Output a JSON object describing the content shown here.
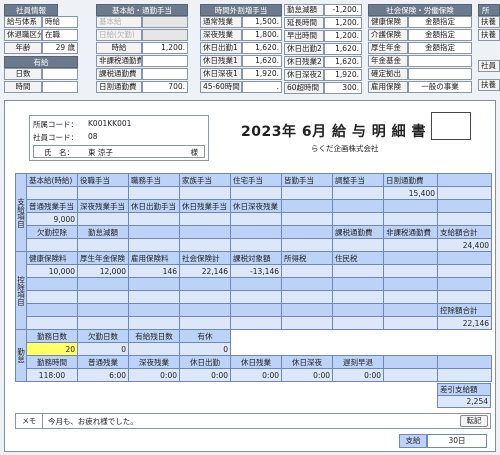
{
  "top": {
    "shain": {
      "title": "社員情報",
      "rows": [
        [
          "給与体系",
          "時給"
        ],
        [
          "休退職区分",
          "在職"
        ],
        [
          "年齢",
          "29 歳"
        ]
      ],
      "yukyu": {
        "title": "有給",
        "rows": [
          [
            "日数",
            ""
          ],
          [
            "時間",
            ""
          ]
        ]
      }
    },
    "kihon": {
      "title": "基本給・通勤手当",
      "rows": [
        [
          "基本給",
          ""
        ],
        [
          "日給(欠勤)",
          ""
        ],
        [
          "時給",
          "1,200."
        ],
        [
          "非課税通勤費",
          ""
        ],
        [
          "課税通勤費",
          ""
        ],
        [
          "日割通勤費",
          "700."
        ]
      ]
    },
    "jikangai": {
      "title": "時間外割増手当",
      "rows": [
        [
          "通常残業",
          "1,500."
        ],
        [
          "深夜残業",
          "1,800."
        ],
        [
          "休日出勤1",
          "1,620."
        ],
        [
          "休日残業1",
          "1,620."
        ],
        [
          "休日深夜1",
          "1,920."
        ],
        [
          "45-60時間",
          "."
        ]
      ]
    },
    "kintai": {
      "rows": [
        [
          "勤怠減額",
          "-1,200."
        ],
        [
          "延長時間",
          "1,200."
        ],
        [
          "早出時間",
          "1,200."
        ],
        [
          "休日出勤2",
          "1,620."
        ],
        [
          "休日残業2",
          "1,620."
        ],
        [
          "休日深夜2",
          "1,920."
        ],
        [
          "60超時間",
          "300."
        ]
      ]
    },
    "shakai": {
      "title": "社会保険・労働保険",
      "rows": [
        [
          "健康保険",
          "金額指定"
        ],
        [
          "介護保険",
          "金額指定"
        ],
        [
          "厚生年金",
          "金額指定"
        ],
        [
          "年金基金",
          ""
        ],
        [
          "確定拠出",
          ""
        ],
        [
          "雇用保険",
          "一般の事業"
        ]
      ]
    },
    "right": {
      "title": "所",
      "rows": [
        "扶養",
        "扶養",
        "",
        "社員",
        "扶養"
      ]
    }
  },
  "slip": {
    "shozoku_label": "所属コード：",
    "shozoku_code": "K001KK001",
    "shain_label": "社員コード：",
    "shain_code": "08",
    "name_label": "氏　名：",
    "name": "東 涼子",
    "sama": "様",
    "title": "2023年 6月 給 与 明 細 書",
    "company": "らくだ企画株式会社"
  },
  "shikyu": {
    "side": "支給項目",
    "r1": [
      "基本給(時給)",
      "役職手当",
      "職務手当",
      "家族手当",
      "住宅手当",
      "皆勤手当",
      "調整手当",
      "日割通勤費",
      ""
    ],
    "v1": [
      "",
      "",
      "",
      "",
      "",
      "",
      "",
      "15,400",
      ""
    ],
    "r2": [
      "普通残業手当",
      "深夜残業手当",
      "休日出勤手当",
      "休日残業手当",
      "休日深夜残業",
      "",
      "",
      "",
      ""
    ],
    "v2": [
      "9,000",
      "",
      "",
      "",
      "",
      "",
      "",
      "",
      ""
    ],
    "r3": [
      "欠勤控除",
      "勤怠減額",
      "",
      "",
      "",
      "",
      "課税通勤費",
      "非課税通勤費",
      "支給額合計"
    ],
    "v3": [
      "",
      "",
      "",
      "",
      "",
      "",
      "",
      "",
      "24,400"
    ]
  },
  "kojo": {
    "side": "控除項目",
    "r1": [
      "健康保険料",
      "厚生年金保険",
      "雇用保険料",
      "社会保険計",
      "課税対象額",
      "所得税",
      "住民税",
      "",
      ""
    ],
    "v1": [
      "10,000",
      "12,000",
      "146",
      "22,146",
      "-13,146",
      "",
      "",
      "",
      ""
    ],
    "r3": [
      "",
      "",
      "",
      "",
      "",
      "",
      "",
      "",
      "控除額合計"
    ],
    "v3": [
      "",
      "",
      "",
      "",
      "",
      "",
      "",
      "",
      "22,146"
    ]
  },
  "kintai_tbl": {
    "side": "勤怠",
    "r1": [
      "勤務日数",
      "欠勤日数",
      "有給残日数",
      "有休"
    ],
    "v1": [
      "20",
      "0",
      "",
      "0"
    ],
    "r2": [
      "勤務時間",
      "普通残業",
      "深夜残業",
      "休日出勤",
      "休日残業",
      "休日深夜",
      "遅刻早退",
      ""
    ],
    "v2": [
      "118:00",
      "6:00",
      "0:00",
      "0:00",
      "0:00",
      "0:00",
      "0:00",
      ""
    ],
    "sashihiki_label": "差引支給額",
    "sashihiki": "2,254"
  },
  "memo": {
    "label": "メモ",
    "text": "今月も、お疲れ様でした。",
    "button": "転記"
  },
  "footer": {
    "label": "支給",
    "value": "30日"
  }
}
